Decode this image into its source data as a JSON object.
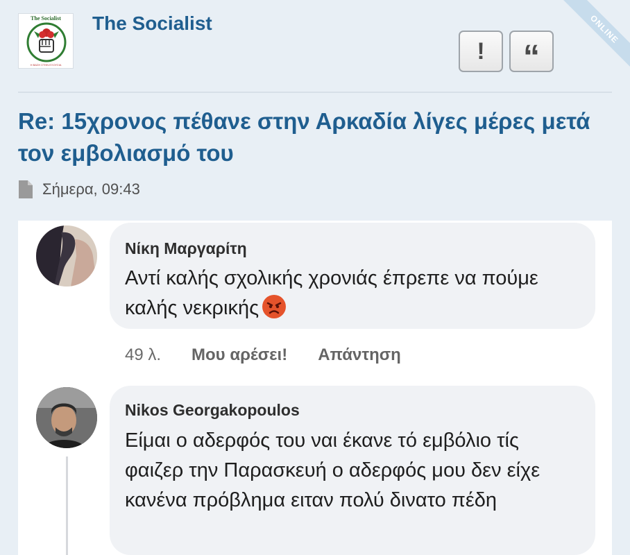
{
  "header": {
    "username": "The Socialist",
    "avatar_title": "The Socialist",
    "avatar_subtitle": "Η ΒΑΣΗ ΣΤΗΝ ΕΞΟΥΣΙΑ",
    "report_label": "!",
    "quote_label": "“",
    "status_badge": "ONLINE",
    "brand_color": "#1f5e8f"
  },
  "thread": {
    "title": "Re: 15χρονος πέθανε στην Αρκαδία λίγες μέρες μετά τον εμβολιασμό του",
    "date": "Σήμερα, 09:43"
  },
  "comments": [
    {
      "author": "Νίκη Μαργαρίτη",
      "text": "Αντί καλής σχολικής χρονιάς έπρεπε να πούμε καλής νεκρικής",
      "reaction_icon": "angry-face-emoji",
      "time": "49 λ.",
      "like_label": "Μου αρέσει!",
      "reply_label": "Απάντηση"
    },
    {
      "author": "Nikos Georgakopoulos",
      "text": "Είμαι ο αδερφός του ναι έκανε τό εμβόλιο τίς φαιζερ την Παρασκευή ο αδερφός μου δεν είχε κανένα πρόβλημα ειταν πολύ δινατο πέδη"
    }
  ]
}
